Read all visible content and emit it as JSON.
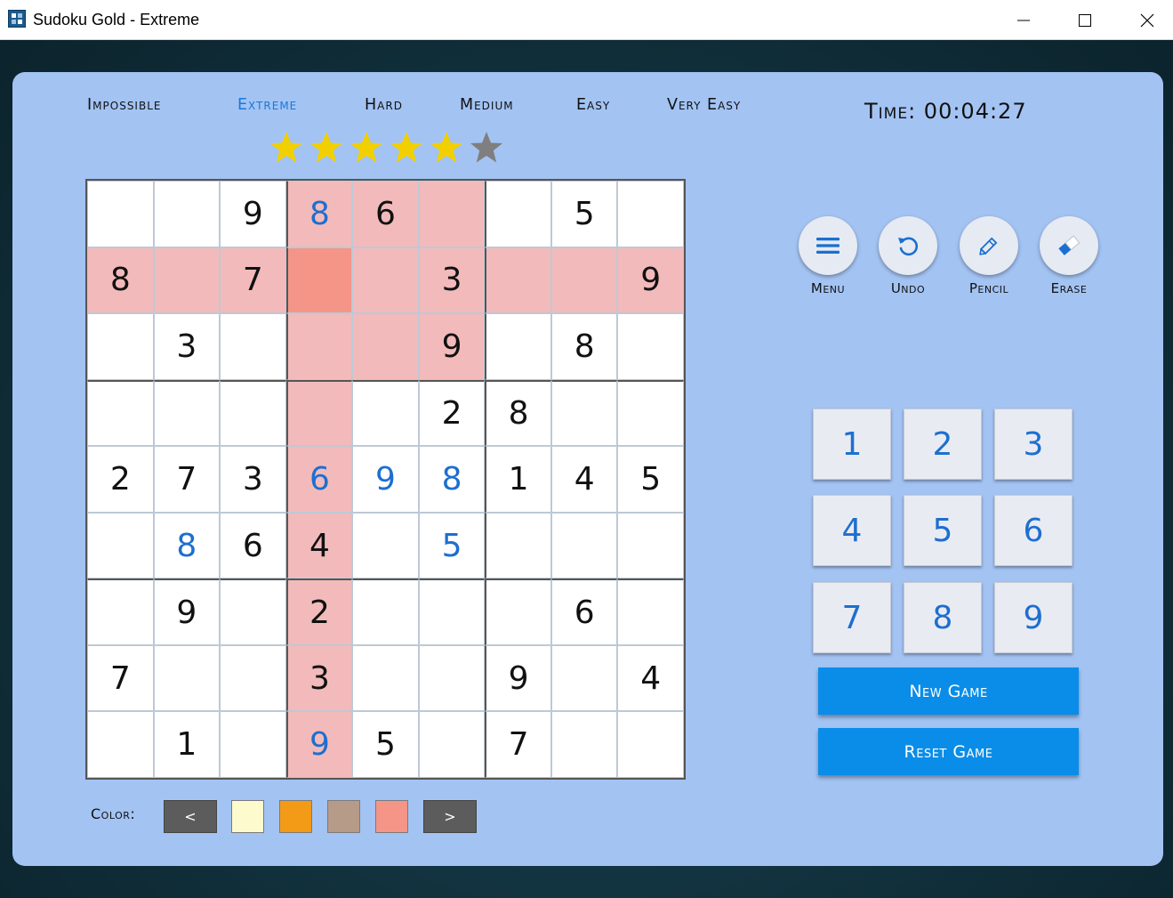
{
  "window": {
    "title": "Sudoku Gold - Extreme",
    "minimize_icon": "minimize-icon",
    "maximize_icon": "maximize-icon",
    "close_icon": "close-icon"
  },
  "difficulty": {
    "levels": [
      "Impossible",
      "Extreme",
      "Hard",
      "Medium",
      "Easy",
      "Very Easy"
    ],
    "active": "Extreme",
    "stars_filled": 5,
    "stars_total": 6
  },
  "timer": {
    "text": "Time: 00:04:27"
  },
  "board": {
    "given": [
      [
        0,
        0,
        9,
        0,
        6,
        0,
        0,
        5,
        0
      ],
      [
        8,
        0,
        7,
        0,
        0,
        3,
        0,
        0,
        9
      ],
      [
        0,
        3,
        0,
        0,
        0,
        9,
        0,
        8,
        0
      ],
      [
        0,
        0,
        0,
        0,
        0,
        2,
        8,
        0,
        0
      ],
      [
        2,
        7,
        3,
        0,
        0,
        0,
        1,
        4,
        5
      ],
      [
        0,
        0,
        6,
        4,
        0,
        0,
        0,
        0,
        0
      ],
      [
        0,
        9,
        0,
        2,
        0,
        0,
        0,
        6,
        0
      ],
      [
        7,
        0,
        0,
        3,
        0,
        0,
        9,
        0,
        4
      ],
      [
        0,
        1,
        0,
        0,
        5,
        0,
        7,
        0,
        0
      ]
    ],
    "entered": [
      [
        0,
        0,
        0,
        8,
        0,
        0,
        0,
        0,
        0
      ],
      [
        0,
        0,
        0,
        0,
        0,
        0,
        0,
        0,
        0
      ],
      [
        0,
        0,
        0,
        0,
        0,
        0,
        0,
        0,
        0
      ],
      [
        0,
        0,
        0,
        0,
        0,
        0,
        0,
        0,
        0
      ],
      [
        0,
        0,
        0,
        6,
        9,
        8,
        0,
        0,
        0
      ],
      [
        0,
        8,
        0,
        0,
        0,
        5,
        0,
        0,
        0
      ],
      [
        0,
        0,
        0,
        0,
        0,
        0,
        0,
        0,
        0
      ],
      [
        0,
        0,
        0,
        0,
        0,
        0,
        0,
        0,
        0
      ],
      [
        0,
        0,
        0,
        9,
        0,
        0,
        0,
        0,
        0
      ]
    ],
    "selected": {
      "row": 1,
      "col": 3
    },
    "highlight_color": "#f3babb",
    "selected_color": "#f49587",
    "entered_color": "#1d6fcf"
  },
  "tools": [
    {
      "label": "Menu",
      "icon": "menu-icon"
    },
    {
      "label": "Undo",
      "icon": "undo-icon"
    },
    {
      "label": "Pencil",
      "icon": "pencil-icon"
    },
    {
      "label": "Erase",
      "icon": "eraser-icon"
    }
  ],
  "numpad": [
    "1",
    "2",
    "3",
    "4",
    "5",
    "6",
    "7",
    "8",
    "9"
  ],
  "actions": {
    "new_game": "New Game",
    "reset_game": "Reset Game"
  },
  "color_bar": {
    "label": "Color:",
    "prev": "<",
    "next": ">",
    "swatches": [
      "#fdfbcd",
      "#f39a17",
      "#b69b88",
      "#f49587"
    ]
  },
  "colors": {
    "panel": "#a3c3f3",
    "accent": "#0a8de8",
    "star_filled": "#f2d000",
    "star_empty": "#7f7f7f"
  }
}
